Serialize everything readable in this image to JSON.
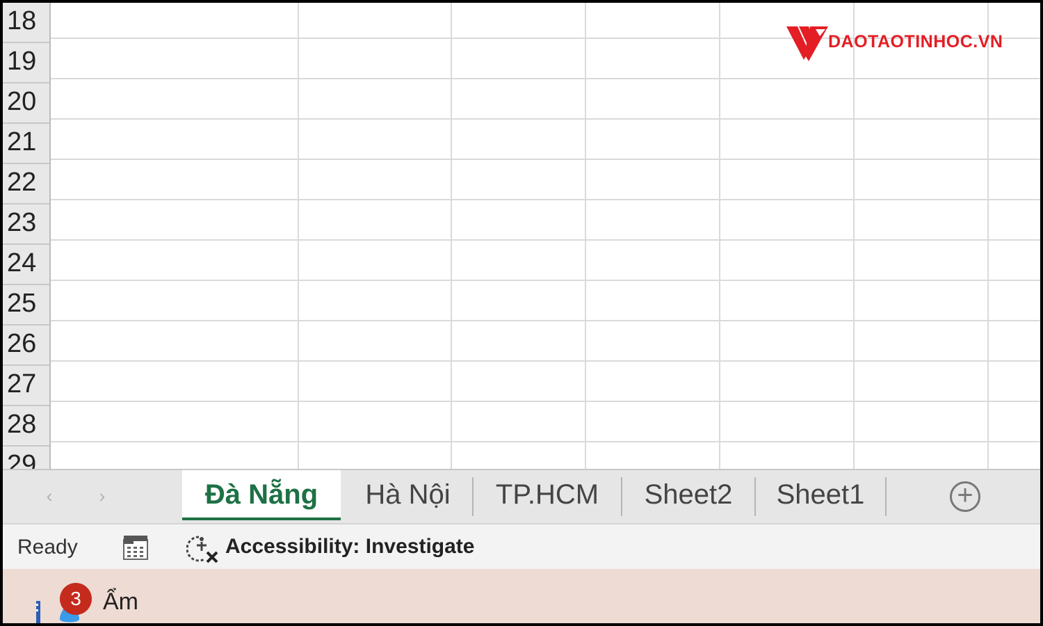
{
  "grid": {
    "rows": [
      "18",
      "19",
      "20",
      "21",
      "22",
      "23",
      "24",
      "25",
      "26",
      "27",
      "28",
      "29"
    ]
  },
  "logo": {
    "text": "DAOTAOTINHOC.VN",
    "color": "#e31e24"
  },
  "sheet_tabs": {
    "prev_arrow": "‹",
    "next_arrow": "›",
    "tabs": [
      {
        "label": "Đà Nẵng",
        "active": true
      },
      {
        "label": "Hà Nội",
        "active": false
      },
      {
        "label": "TP.HCM",
        "active": false
      },
      {
        "label": "Sheet2",
        "active": false
      },
      {
        "label": "Sheet1",
        "active": false
      }
    ],
    "add_sheet_label": "+",
    "active_color": "#1e7145"
  },
  "status_bar": {
    "ready": "Ready",
    "macro_icon": "macro-recording-icon",
    "accessibility_icon": "accessibility-investigate-icon",
    "accessibility_text": "Accessibility: Investigate"
  },
  "taskbar": {
    "badge": "3",
    "weather_text": "Ẩm",
    "badge_color": "#c42b1c"
  }
}
